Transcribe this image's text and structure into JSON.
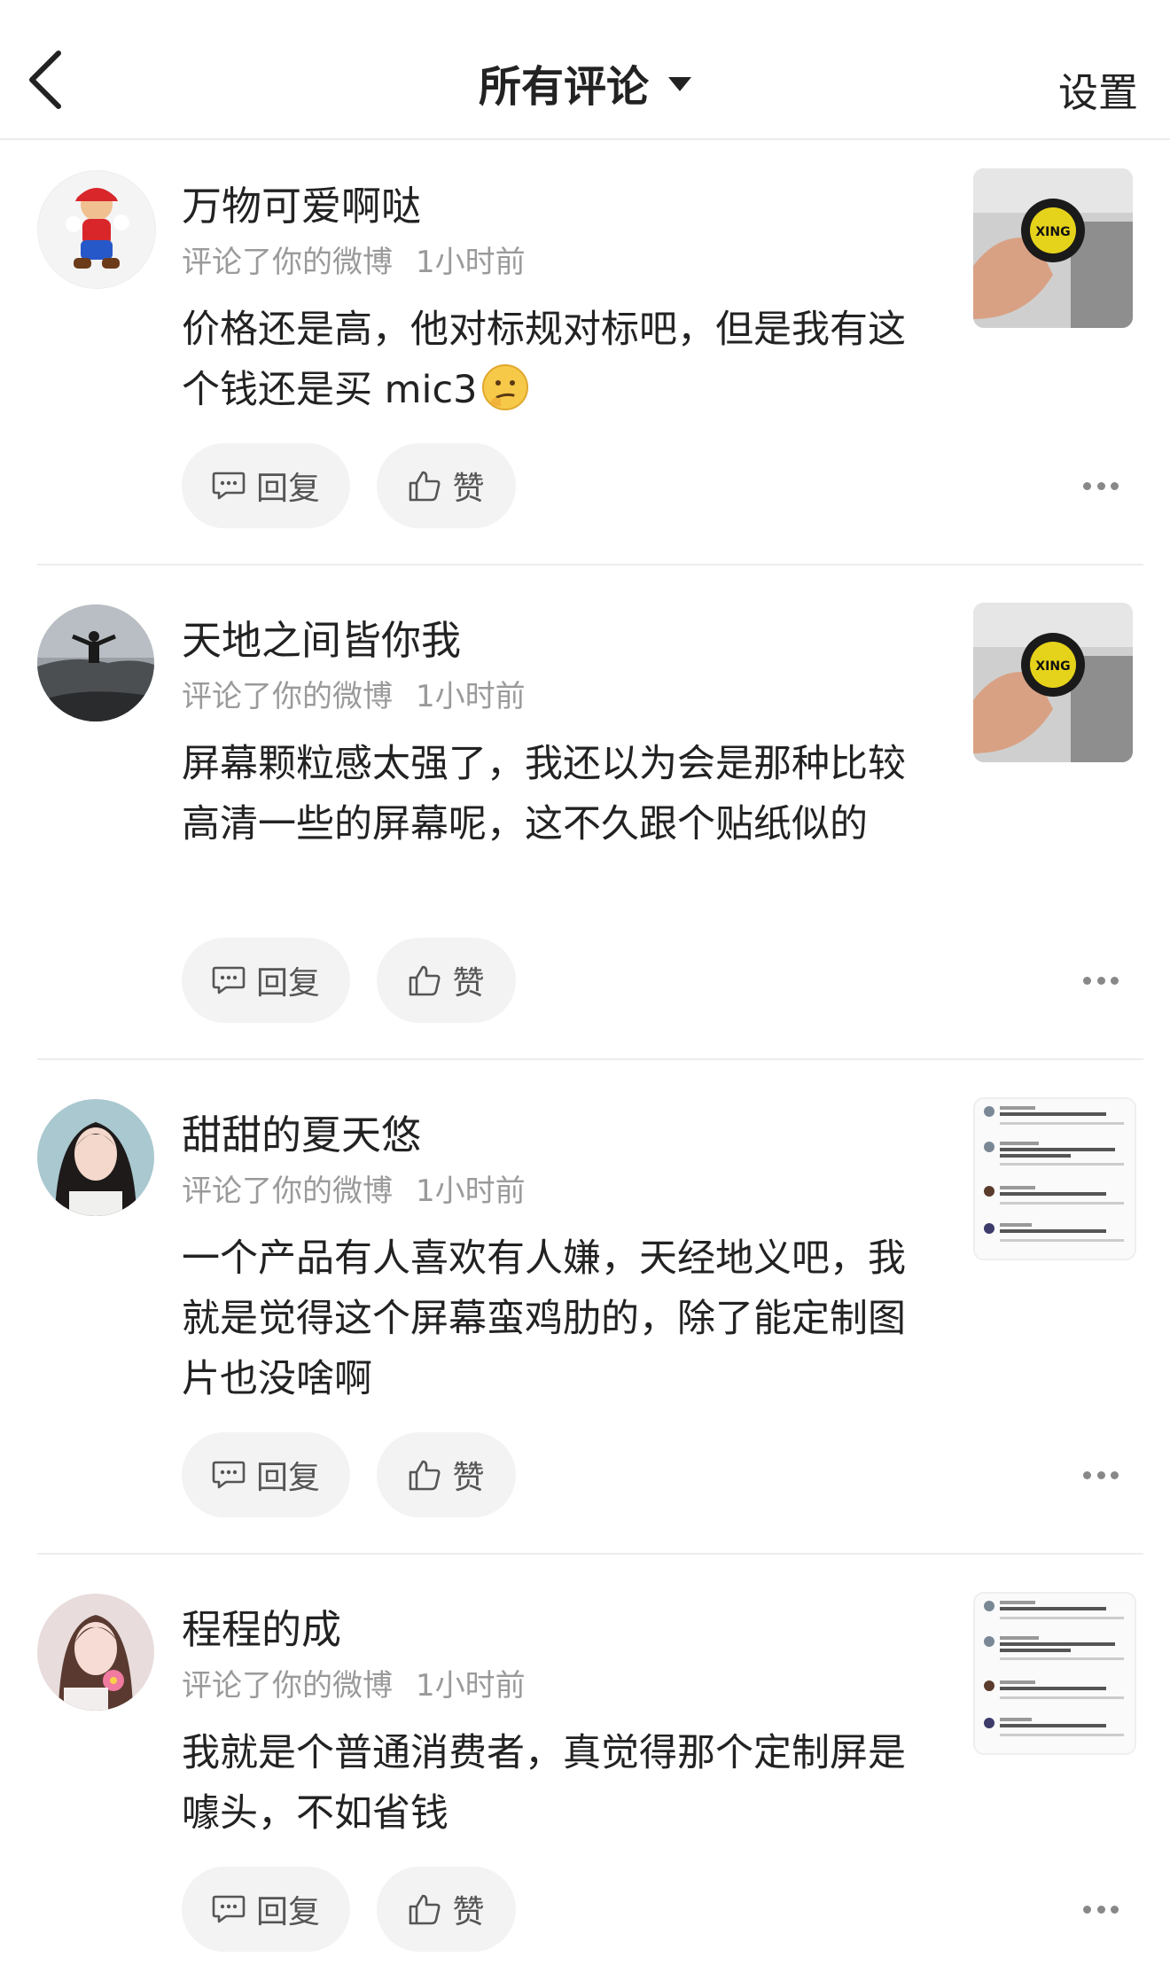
{
  "header": {
    "title": "所有评论",
    "settings_label": "设置"
  },
  "actions": {
    "reply_label": "回复",
    "like_label": "赞"
  },
  "comments": [
    {
      "username": "万物可爱啊哒",
      "action": "评论了你的微博",
      "time": "1小时前",
      "text": "价格还是高，他对标规对标吧，但是我有这个钱还是买 mic3",
      "emoji": "thinking-face-emoji",
      "avatar": "mario-avatar",
      "thumbnail": "product-photo-thumbnail",
      "thumbnail_text": "XING"
    },
    {
      "username": "天地之间皆你我",
      "action": "评论了你的微博",
      "time": "1小时前",
      "text": "屏幕颗粒感太强了，我还以为会是那种比较高清一些的屏幕呢，这不久跟个贴纸似的",
      "avatar": "mountain-person-avatar",
      "thumbnail": "product-photo-thumbnail",
      "thumbnail_text": "XING"
    },
    {
      "username": "甜甜的夏天悠",
      "action": "评论了你的微博",
      "time": "1小时前",
      "text": "一个产品有人喜欢有人嫌，天经地义吧，我就是觉得这个屏幕蛮鸡肋的，除了能定制图片也没啥啊",
      "avatar": "girl-portrait-avatar",
      "thumbnail": "comment-screenshot-thumbnail"
    },
    {
      "username": "程程的成",
      "action": "评论了你的微博",
      "time": "1小时前",
      "text": "我就是个普通消费者，真觉得那个定制屏是噱头，不如省钱",
      "avatar": "girl-flower-avatar",
      "thumbnail": "comment-screenshot-thumbnail"
    }
  ],
  "colors": {
    "text": "#222222",
    "meta": "#9a9a9a",
    "pill_bg": "#f3f3f3",
    "divider": "#ededed"
  }
}
